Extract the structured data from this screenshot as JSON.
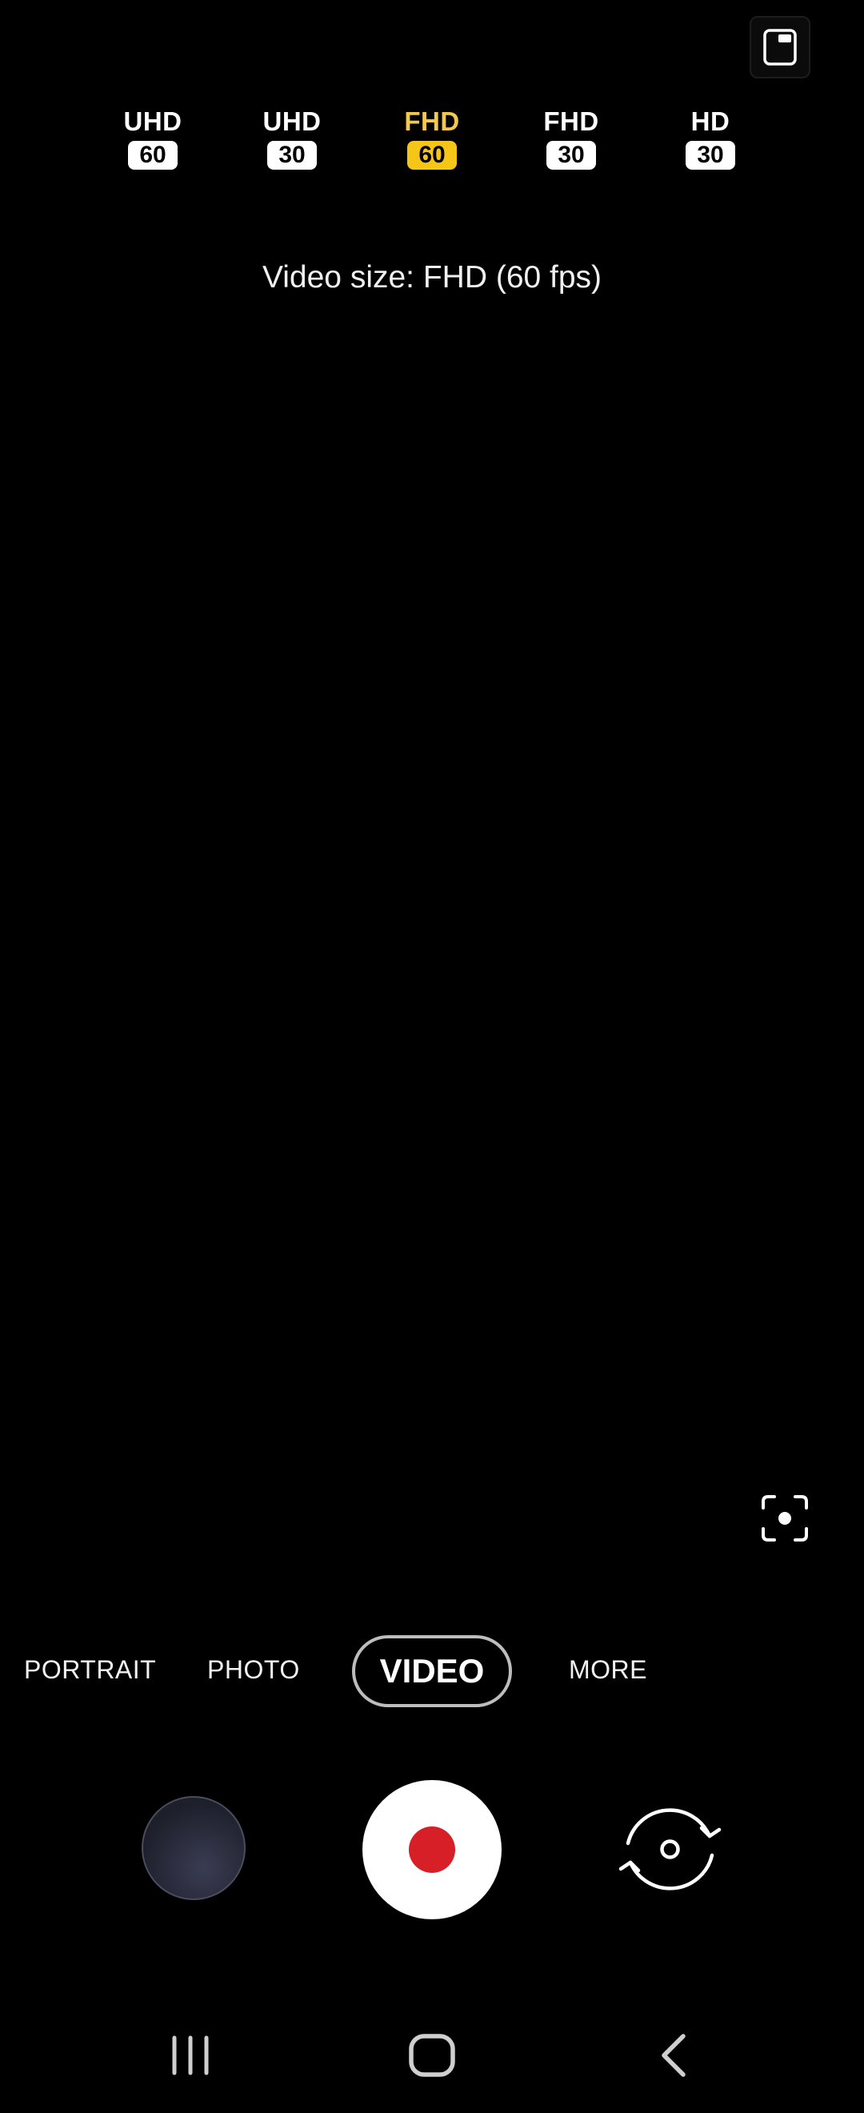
{
  "resolutions": [
    {
      "label": "UHD",
      "fps": "60"
    },
    {
      "label": "UHD",
      "fps": "30"
    },
    {
      "label": "FHD",
      "fps": "60"
    },
    {
      "label": "FHD",
      "fps": "30"
    },
    {
      "label": "HD",
      "fps": "30"
    }
  ],
  "selected_resolution_index": 2,
  "video_size_text": "Video size: FHD (60 fps)",
  "modes": {
    "portrait": "PORTRAIT",
    "photo": "PHOTO",
    "video": "VIDEO",
    "more": "MORE"
  },
  "icons": {
    "ratio": "aspect-ratio-icon",
    "focus": "scene-focus-icon",
    "record": "record-icon",
    "flip": "switch-camera-icon",
    "recents": "recent-apps-icon",
    "home": "home-icon",
    "back": "back-icon"
  },
  "colors": {
    "accent": "#f5c518",
    "record": "#d61f26",
    "background": "#000000"
  }
}
